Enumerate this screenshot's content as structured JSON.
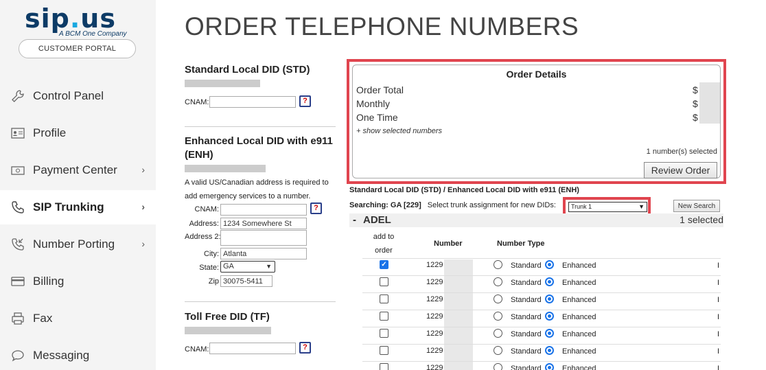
{
  "brand": {
    "logo_text_a": "sip",
    "logo_dot": ".",
    "logo_text_b": "us",
    "tagline": "A BCM One Company",
    "portal_button": "CUSTOMER PORTAL"
  },
  "sidebar": {
    "items": [
      {
        "label": "Control Panel",
        "icon": "wrench-icon"
      },
      {
        "label": "Profile",
        "icon": "id-card-icon"
      },
      {
        "label": "Payment Center",
        "icon": "cash-icon",
        "chevron": "›"
      },
      {
        "label": "SIP Trunking",
        "icon": "phone-icon",
        "chevron": "›",
        "active": true
      },
      {
        "label": "Number Porting",
        "icon": "phone-incoming-icon",
        "chevron": "›"
      },
      {
        "label": "Billing",
        "icon": "credit-card-icon"
      },
      {
        "label": "Fax",
        "icon": "fax-icon"
      },
      {
        "label": "Messaging",
        "icon": "chat-bubble-icon"
      }
    ]
  },
  "page": {
    "title": "ORDER TELEPHONE NUMBERS"
  },
  "std": {
    "title": "Standard Local DID (STD)",
    "cnam_label": "CNAM:",
    "cnam_value": "",
    "help": "?"
  },
  "enh": {
    "title_line1": "Enhanced Local DID with e911",
    "title_line2": "(ENH)",
    "note_line1": "A valid US/Canadian address is required to",
    "note_line2": "add emergency services to a number.",
    "cnam_label": "CNAM:",
    "cnam_value": "",
    "address_label": "Address:",
    "address_value": "1234 Somewhere St",
    "address2_label": "Address 2:",
    "address2_value": "",
    "city_label": "City:",
    "city_value": "Atlanta",
    "state_label": "State:",
    "state_value": "GA",
    "zip_label": "Zip",
    "zip_value": "30075-5411",
    "help": "?"
  },
  "tf": {
    "title": "Toll Free DID (TF)",
    "cnam_label": "CNAM:",
    "cnam_value": "",
    "help": "?"
  },
  "order": {
    "title": "Order Details",
    "total_label": "Order Total",
    "monthly_label": "Monthly",
    "onetime_label": "One Time",
    "currency": "$",
    "show_selected": "+ show selected numbers",
    "selected_count": "1 number(s) selected",
    "review_button": "Review Order"
  },
  "search": {
    "heading": "Standard Local DID (STD) / Enhanced Local DID with e911 (ENH)",
    "searching_label": "Searching: GA [229]",
    "trunk_prompt": "Select trunk assignment for new DIDs:",
    "trunk_value": "Trunk 1",
    "new_search": "New Search",
    "group_toggle": "-",
    "group_name": "ADEL",
    "group_selected": "1 selected",
    "col_add_line1": "add to",
    "col_add_line2": "order",
    "col_number": "Number",
    "col_type": "Number Type",
    "opt_standard": "Standard",
    "opt_enhanced": "Enhanced",
    "trail_char": "I",
    "rows": [
      {
        "number": "1229",
        "checked": true
      },
      {
        "number": "1229",
        "checked": false
      },
      {
        "number": "1229",
        "checked": false
      },
      {
        "number": "1229",
        "checked": false
      },
      {
        "number": "1229",
        "checked": false
      },
      {
        "number": "1229",
        "checked": false
      },
      {
        "number": "1229",
        "checked": false
      }
    ]
  }
}
